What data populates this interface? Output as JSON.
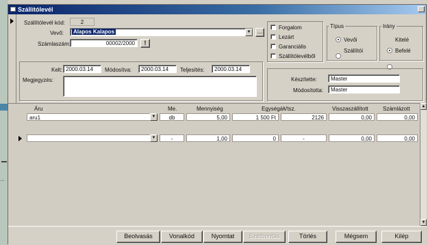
{
  "window": {
    "title": "Szállítólevél"
  },
  "header": {
    "kod_label": "Szállítólevél kód:",
    "kod_value": "2",
    "vevo_label": "Vevő:",
    "vevo_value": "Alapos Kalapos",
    "szamlaszam_label": "Számlaszám:",
    "szamlaszam_value": "00002/2000",
    "szamlaszam_btn": "!",
    "vevo_more_btn": "...",
    "kelt_label": "Kelt:",
    "kelt_value": "2000.03.14",
    "modositva_label": "Módosítva:",
    "modositva_value": "2000.03.14",
    "teljesites_label": "Teljesítés:",
    "teljesites_value": "2000.03.14",
    "megjegyzes_label": "Megjegyzés:",
    "megjegyzes_value": ""
  },
  "flags": {
    "forgalom": "Forgalom",
    "lezart": "Lezárt",
    "garancialis": "Garanciális",
    "szallitolevelbol": "Szállítólevélből"
  },
  "tipus": {
    "title": "Típus",
    "options": [
      "Vevői",
      "Szállítói"
    ],
    "selected": "Vevői"
  },
  "irany": {
    "title": "Irány",
    "options": [
      "Kitelé",
      "Befelé"
    ],
    "selected": "Kitelé"
  },
  "meta": {
    "keszitette_label": "Készítette:",
    "keszitette_value": "Master",
    "modositotta_label": "Módosította:",
    "modositotta_value": "Master"
  },
  "grid": {
    "columns": [
      "Áru",
      "Me.",
      "Mennyiség",
      "Egységár",
      "Vtsz.",
      "Visszaszállított",
      "Számlázott"
    ],
    "rows": [
      {
        "aru": "aru1",
        "me": "db",
        "mennyiseg": "5,00",
        "egysegar": "1 500 Ft",
        "vtsz": "2126",
        "vissza": "0,00",
        "szamlazott": "0,00"
      },
      {
        "aru": "",
        "me": "-",
        "mennyiseg": "1,00",
        "egysegar": "0",
        "vtsz": "-",
        "vissza": "0,00",
        "szamlazott": "0,00"
      }
    ]
  },
  "toolbar": {
    "beolvasas": "Beolvasás",
    "vonalkod": "Vonalkód",
    "nyomtat": "Nyomtat",
    "szetbontas": "Szétbontás",
    "torles": "Törlés",
    "megsem": "Mégsem",
    "kilep": "Kilép"
  },
  "side": {
    "dots": "..."
  },
  "colors": {
    "selection": "#0a246a",
    "window_bg": "#d6d1c6"
  }
}
